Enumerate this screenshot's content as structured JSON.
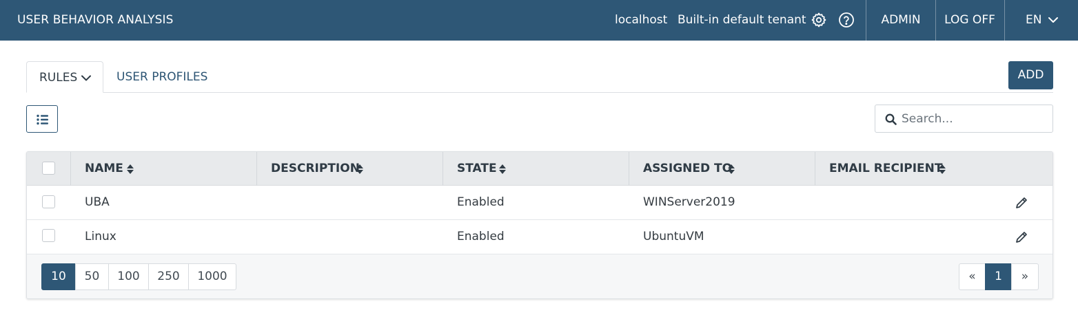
{
  "header": {
    "app_title": "USER BEHAVIOR ANALYSIS",
    "host": "localhost",
    "tenant": "Built-in default tenant",
    "settings_icon": "gear-icon",
    "help_icon": "help-circle-icon",
    "admin_label": "ADMIN",
    "logoff_label": "LOG OFF",
    "language": "EN",
    "background_color": "#2e5776"
  },
  "tabs": [
    {
      "label": "RULES",
      "active": true
    },
    {
      "label": "USER PROFILES",
      "active": false
    }
  ],
  "toolbar": {
    "add_label": "ADD",
    "view_toggle_icon": "list-icon",
    "search_placeholder": "Search..."
  },
  "table": {
    "columns": [
      "NAME",
      "DESCRIPTION",
      "STATE",
      "ASSIGNED TO",
      "EMAIL RECIPIENT"
    ],
    "rows": [
      {
        "name": "UBA",
        "description": "",
        "state": "Enabled",
        "assigned_to": "WINServer2019",
        "email_recipient": ""
      },
      {
        "name": "Linux",
        "description": "",
        "state": "Enabled",
        "assigned_to": "UbuntuVM",
        "email_recipient": ""
      }
    ],
    "row_action_icon": "pencil-icon"
  },
  "pagination": {
    "page_sizes": [
      "10",
      "50",
      "100",
      "250",
      "1000"
    ],
    "selected_page_size": "10",
    "prev": "«",
    "current_page": "1",
    "next": "»"
  }
}
